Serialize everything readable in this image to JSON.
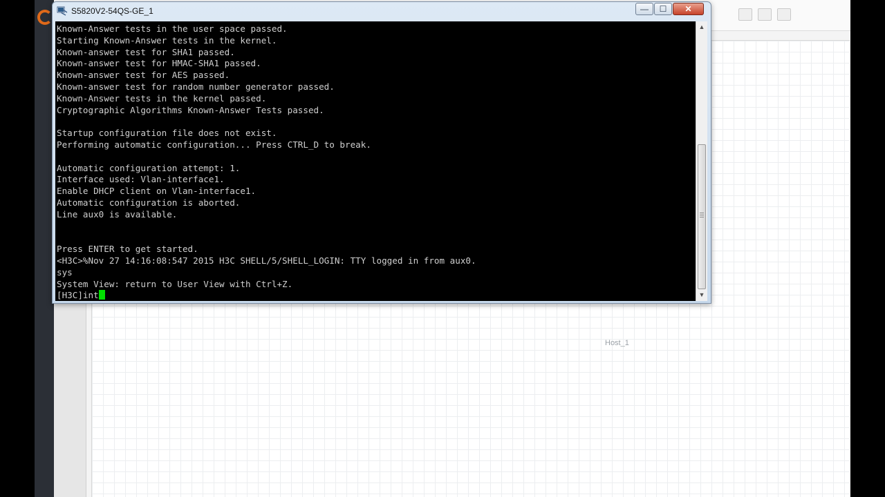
{
  "window": {
    "title": "S5820V2-54QS-GE_1",
    "minimize_label": "—",
    "maximize_label": "☐",
    "close_label": "✕"
  },
  "terminal": {
    "lines": [
      "Known-Answer tests in the user space passed.",
      "Starting Known-Answer tests in the kernel.",
      "Known-answer test for SHA1 passed.",
      "Known-answer test for HMAC-SHA1 passed.",
      "Known-answer test for AES passed.",
      "Known-answer test for random number generator passed.",
      "Known-Answer tests in the kernel passed.",
      "Cryptographic Algorithms Known-Answer Tests passed.",
      "",
      "Startup configuration file does not exist.",
      "Performing automatic configuration... Press CTRL_D to break.",
      "",
      "Automatic configuration attempt: 1.",
      "Interface used: Vlan-interface1.",
      "Enable DHCP client on Vlan-interface1.",
      "Automatic configuration is aborted.",
      "Line aux0 is available.",
      "",
      "",
      "Press ENTER to get started.",
      "<H3C>%Nov 27 14:16:08:547 2015 H3C SHELL/5/SHELL_LOGIN: TTY logged in from aux0.",
      "sys",
      "System View: return to User View with Ctrl+Z."
    ],
    "prompt_line": "[H3C]int"
  },
  "scrollbar": {
    "up_arrow": "▲",
    "down_arrow": "▼"
  },
  "background_app": {
    "node_label": "Host_1"
  },
  "colors": {
    "terminal_bg": "#000000",
    "terminal_fg": "#cfcfcf",
    "cursor": "#00e000",
    "close_button": "#c7432a"
  }
}
